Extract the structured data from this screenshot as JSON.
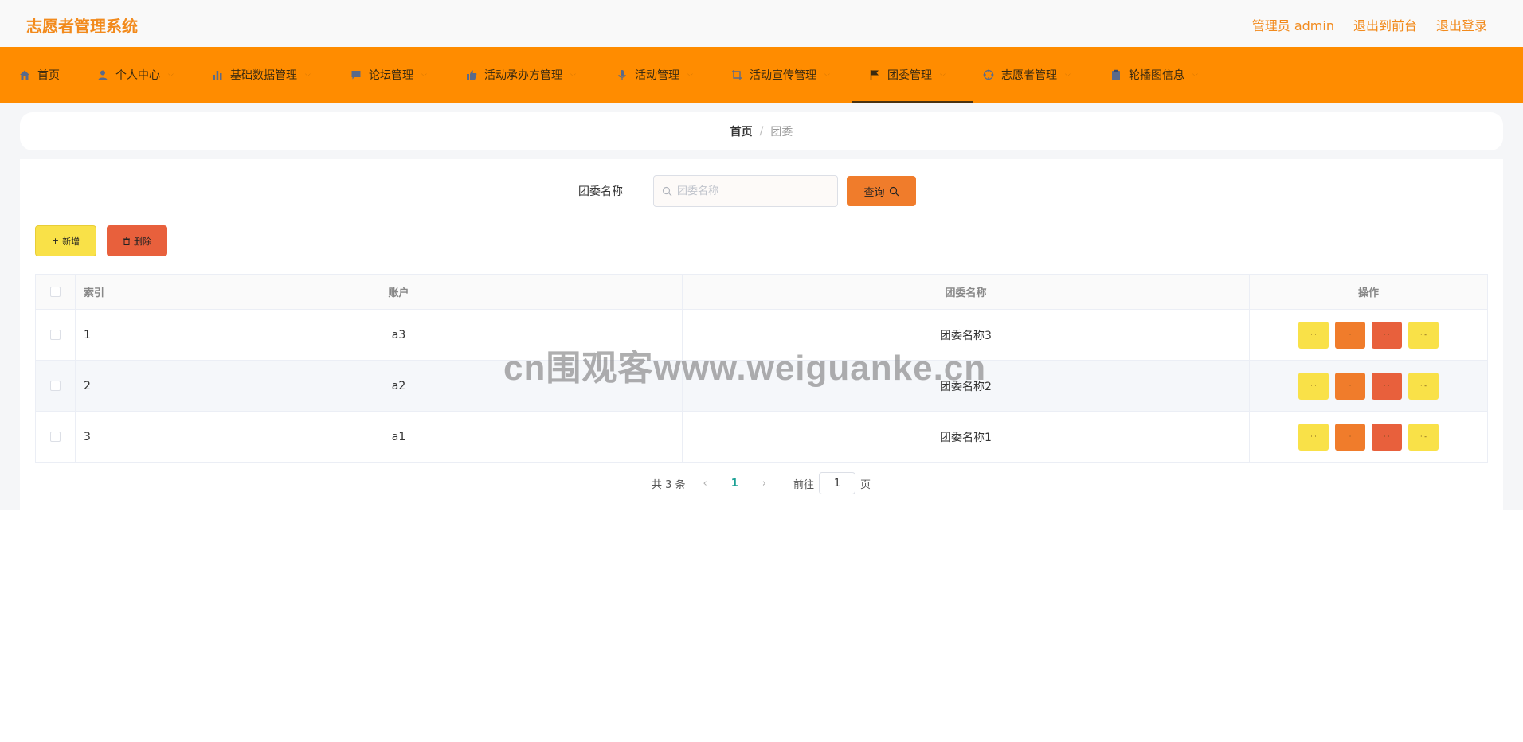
{
  "app": {
    "title": "志愿者管理系统",
    "admin_label": "管理员 admin",
    "to_front_label": "退出到前台",
    "logout_label": "退出登录"
  },
  "nav": {
    "items": [
      {
        "label": "首页",
        "icon": "home-icon"
      },
      {
        "label": "个人中心",
        "icon": "user-icon"
      },
      {
        "label": "基础数据管理",
        "icon": "bar-chart-icon"
      },
      {
        "label": "论坛管理",
        "icon": "chat-icon"
      },
      {
        "label": "活动承办方管理",
        "icon": "thumbs-up-icon"
      },
      {
        "label": "活动管理",
        "icon": "microphone-icon"
      },
      {
        "label": "活动宣传管理",
        "icon": "crop-icon"
      },
      {
        "label": "团委管理",
        "icon": "flag-icon"
      },
      {
        "label": "志愿者管理",
        "icon": "crosshair-icon"
      },
      {
        "label": "轮播图信息",
        "icon": "clipboard-icon"
      }
    ],
    "active": "团委管理"
  },
  "breadcrumb": {
    "home": "首页",
    "separator": "/",
    "current": "团委"
  },
  "search": {
    "label": "团委名称",
    "placeholder": "团委名称",
    "query_button": "查询"
  },
  "actions": {
    "add_label": "新增",
    "delete_label": "删除"
  },
  "table": {
    "columns": [
      "索引",
      "账户",
      "团委名称",
      "操作"
    ],
    "rows": [
      {
        "index": "1",
        "account": "a3",
        "name": "团委名称3"
      },
      {
        "index": "2",
        "account": "a2",
        "name": "团委名称2"
      },
      {
        "index": "3",
        "account": "a1",
        "name": "团委名称1"
      }
    ],
    "row_buttons": [
      {
        "label": "· ·",
        "color": "#f9e148"
      },
      {
        "label": "·",
        "color": "#f07c2b"
      },
      {
        "label": "· ·",
        "color": "#e8603c"
      },
      {
        "label": "· -",
        "color": "#f9e148"
      }
    ]
  },
  "pagination": {
    "total_text": "共 3 条",
    "current_page": "1",
    "goto_label": "前往",
    "goto_value": "1",
    "page_suffix": "页"
  },
  "watermark": "cn围观客www.weiguanke.cn",
  "colors": {
    "brand": "#f28a1c",
    "nav_bg": "#ff8c00",
    "query_btn": "#f07c2b",
    "add_btn": "#f9e148",
    "delete_btn": "#e8603c",
    "page_active": "#1aa094"
  }
}
